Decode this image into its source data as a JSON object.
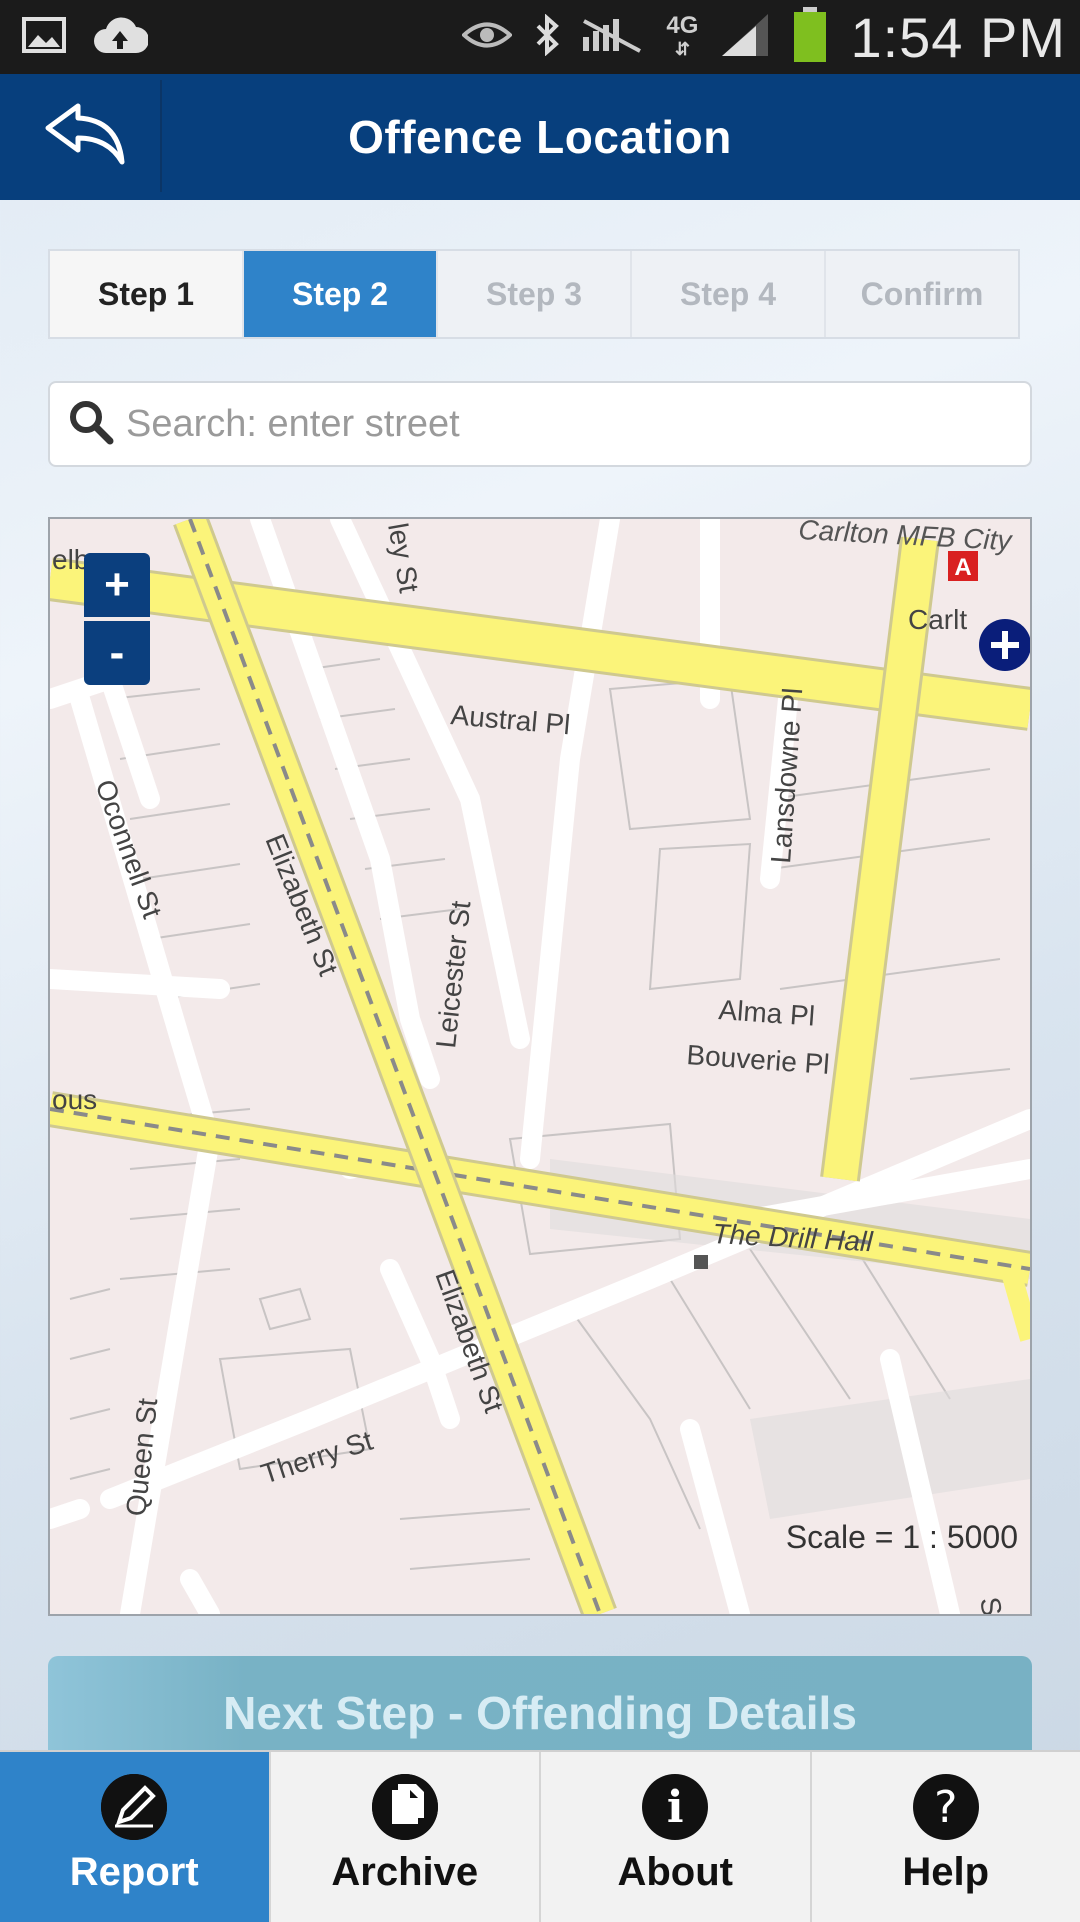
{
  "status_bar": {
    "network": "4G",
    "time": "1:54 PM",
    "icons": [
      "image-icon",
      "cloud-upload-icon",
      "eye-icon",
      "bluetooth-icon",
      "no-signal-icon",
      "signal-icon",
      "battery-icon"
    ]
  },
  "header": {
    "title": "Offence Location",
    "back_icon": "back-arrow-icon"
  },
  "steps": [
    {
      "label": "Step 1",
      "state": "done"
    },
    {
      "label": "Step 2",
      "state": "active"
    },
    {
      "label": "Step 3",
      "state": "disabled"
    },
    {
      "label": "Step 4",
      "state": "disabled"
    },
    {
      "label": "Confirm",
      "state": "disabled"
    }
  ],
  "search": {
    "placeholder": "Search: enter street",
    "value": ""
  },
  "map": {
    "zoom_in": "+",
    "zoom_out": "-",
    "scale": "Scale = 1 : 5000",
    "labels": {
      "austral": "Austral Pl",
      "lansdowne": "Lansdowne Pl",
      "oconnell": "Oconnell St",
      "elizabeth1": "Elizabeth St",
      "elizabeth2": "Elizabeth St",
      "leicester": "Leicester St",
      "alma": "Alma Pl",
      "bouverie": "Bouverie Pl",
      "drill_hall": "The Drill Hall",
      "therry": "Therry St",
      "queen": "Queen St",
      "carlton_mfb": "Carlton MFB City",
      "carlton": "Carlt",
      "elb": "elb",
      "ous": "ous",
      "ley": "ley St",
      "s": "S"
    }
  },
  "next_step": {
    "label": "Next Step - Offending Details"
  },
  "tabs": [
    {
      "label": "Report",
      "icon": "pencil-icon",
      "active": true
    },
    {
      "label": "Archive",
      "icon": "documents-icon",
      "active": false
    },
    {
      "label": "About",
      "icon": "info-icon",
      "active": false
    },
    {
      "label": "Help",
      "icon": "question-icon",
      "active": false
    }
  ],
  "colors": {
    "header": "#073f7d",
    "accent": "#2f83c9",
    "map_bg": "#f3eaea",
    "major_road": "#fbf47a"
  }
}
